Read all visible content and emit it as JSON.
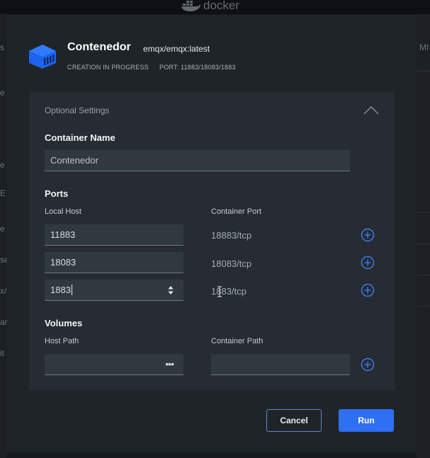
{
  "background": {
    "app_name": "docker",
    "left_fragments": [
      "s",
      "e",
      "e",
      "E",
      "e",
      "se",
      "x/",
      "ar",
      "it"
    ],
    "right_fragments": [
      "MI"
    ]
  },
  "modal": {
    "title": "Contenedor",
    "image": "emqx/emqx:latest",
    "status": "CREATION IN PROGRESS",
    "ports_info": "PORT: 11883/18083/1883"
  },
  "settings": {
    "title": "Optional Settings",
    "container_name_label": "Container Name",
    "container_name_value": "Contenedor",
    "ports_label": "Ports",
    "local_host_label": "Local Host",
    "container_port_label": "Container Port",
    "ports": [
      {
        "local": "11883",
        "container": "18883/tcp"
      },
      {
        "local": "18083",
        "container": "18083/tcp"
      },
      {
        "local": "1883",
        "container": "1883/tcp"
      }
    ],
    "volumes_label": "Volumes",
    "host_path_label": "Host Path",
    "container_path_label": "Container Path",
    "host_path_value": "",
    "container_path_value": "",
    "browse_glyph": "•••"
  },
  "actions": {
    "cancel": "Cancel",
    "run": "Run"
  },
  "colors": {
    "accent": "#2f6ff2",
    "modal_bg": "#1f2428",
    "panel_bg": "#262c31",
    "input_bg": "#313940",
    "docker_blue": "#1d63ed"
  }
}
